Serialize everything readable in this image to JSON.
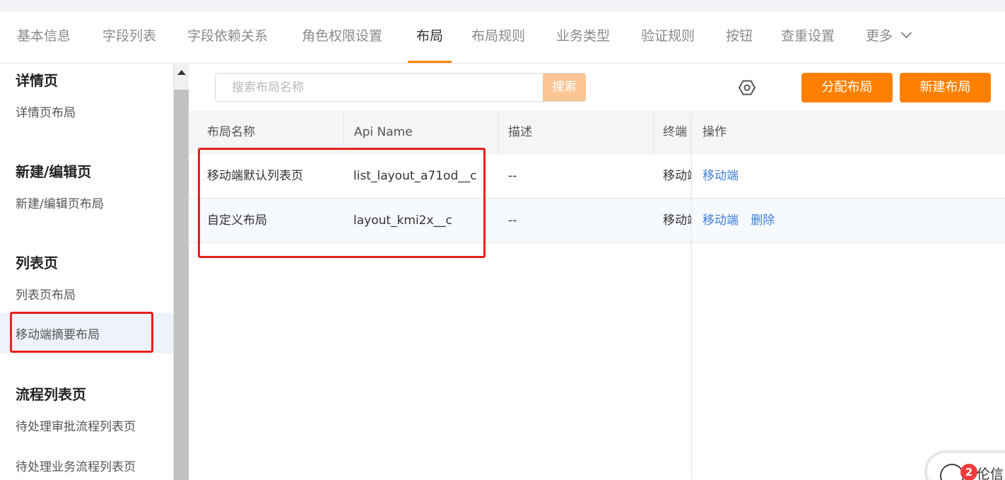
{
  "tabs": [
    {
      "label": "基本信息"
    },
    {
      "label": "字段列表"
    },
    {
      "label": "字段依赖关系"
    },
    {
      "label": "角色权限设置"
    },
    {
      "label": "布局"
    },
    {
      "label": "布局规则"
    },
    {
      "label": "业务类型"
    },
    {
      "label": "验证规则"
    },
    {
      "label": "按钮"
    },
    {
      "label": "查重设置"
    },
    {
      "label": "更多"
    }
  ],
  "active_tab": "布局",
  "sidebar": {
    "sections": [
      {
        "title": "详情页",
        "items": [
          "详情页布局"
        ]
      },
      {
        "title": "新建/编辑页",
        "items": [
          "新建/编辑页布局"
        ]
      },
      {
        "title": "列表页",
        "items": [
          "列表页布局",
          "移动端摘要布局"
        ]
      },
      {
        "title": "流程列表页",
        "items": [
          "待处理审批流程列表页",
          "待处理业务流程列表页"
        ]
      }
    ],
    "selected_item": "移动端摘要布局"
  },
  "toolbar": {
    "search_placeholder": "搜索布局名称",
    "search_button": "搜索",
    "settings_icon": "settings-icon",
    "assign_button": "分配布局",
    "new_button": "新建布局"
  },
  "table": {
    "columns": [
      "布局名称",
      "Api Name",
      "描述",
      "终端",
      "操作"
    ],
    "rows": [
      {
        "name": "移动端默认列表页",
        "api_name": "list_layout_a71od__c",
        "desc": "--",
        "terminal": "移动端",
        "actions": [
          "移动端"
        ]
      },
      {
        "name": "自定义布局",
        "api_name": "layout_kmi2x__c",
        "desc": "--",
        "terminal": "移动端",
        "actions": [
          "移动端",
          "删除"
        ]
      }
    ]
  },
  "widget": {
    "badge_count": "2",
    "text": "伦信"
  },
  "colors": {
    "accent": "#ff8000",
    "link": "#3f7fd5",
    "highlight": "#e8201c"
  }
}
